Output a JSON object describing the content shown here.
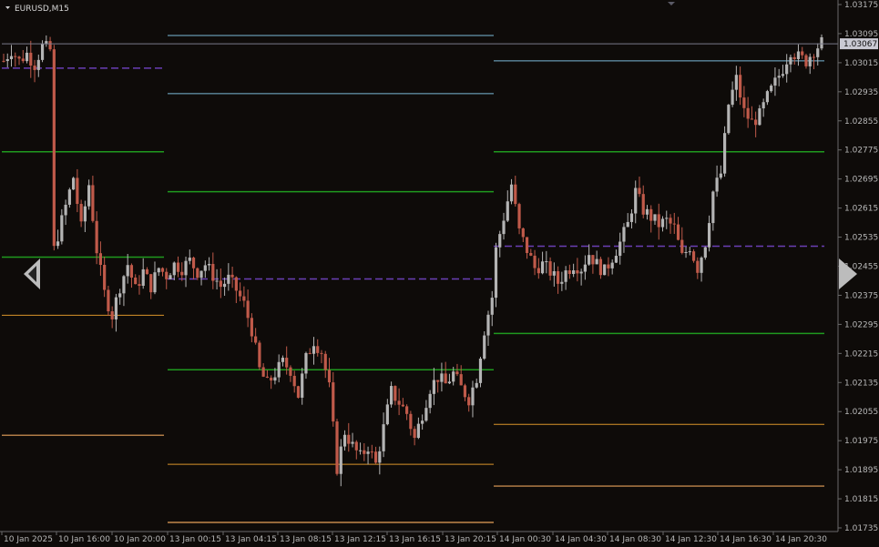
{
  "window": {
    "title": "EURUSD,M15"
  },
  "current_price_label": "1.03067",
  "colors": {
    "background": "#0e0b09",
    "axis": "#6a6a6a",
    "bull_candle": "#b4b4b4",
    "bear_candle": "#c05a4a",
    "pivot": "#6a3fb5",
    "resistance_far": "#7ab8d8",
    "resistance": "#1f9a1f",
    "support": "#d9932a",
    "support_far": "#e6a15a",
    "current_price_line": "#7a7a8a"
  },
  "chart_data": {
    "type": "candlestick",
    "symbol": "EURUSD",
    "timeframe": "M15",
    "y_ticks": [
      "1.03175",
      "1.03095",
      "1.03015",
      "1.02935",
      "1.02855",
      "1.02775",
      "1.02695",
      "1.02615",
      "1.02535",
      "1.02455",
      "1.02375",
      "1.02295",
      "1.02215",
      "1.02135",
      "1.02055",
      "1.01975",
      "1.01895",
      "1.01815",
      "1.01735"
    ],
    "x_ticks": [
      "10 Jan 2025",
      "10 Jan 16:00",
      "10 Jan 20:00",
      "13 Jan 00:15",
      "13 Jan 04:15",
      "13 Jan 08:15",
      "13 Jan 12:15",
      "13 Jan 16:15",
      "13 Jan 20:15",
      "14 Jan 00:30",
      "14 Jan 04:30",
      "14 Jan 08:30",
      "14 Jan 12:30",
      "14 Jan 16:30",
      "14 Jan 20:30"
    ],
    "ylim": [
      1.0171,
      1.0318
    ],
    "current_price": 1.03067,
    "pivot_levels": [
      {
        "segment": 1,
        "pivot": 1.03,
        "r1": 1.0277,
        "s1": 1.0248,
        "s2": 1.0232,
        "s3": 1.0199
      },
      {
        "segment": 2,
        "r3": 1.0309,
        "r2": 1.0293,
        "r1": 1.0266,
        "pivot": 1.0242,
        "s1": 1.0217,
        "s2": 1.0191,
        "s3": 1.0175
      },
      {
        "segment": 3,
        "r2": 1.0302,
        "r1": 1.0277,
        "pivot": 1.0251,
        "s1": 1.0227,
        "s2": 1.0202,
        "s3": 1.0185
      }
    ],
    "path": [
      [
        0,
        1.0302
      ],
      [
        2,
        1.0305
      ],
      [
        4,
        1.0302
      ],
      [
        6,
        1.0304
      ],
      [
        8,
        1.0301
      ],
      [
        10,
        1.0306
      ],
      [
        12,
        1.0305
      ],
      [
        13,
        1.025
      ],
      [
        16,
        1.0262
      ],
      [
        18,
        1.027
      ],
      [
        20,
        1.0256
      ],
      [
        22,
        1.0268
      ],
      [
        24,
        1.025
      ],
      [
        26,
        1.0238
      ],
      [
        28,
        1.0232
      ],
      [
        30,
        1.024
      ],
      [
        32,
        1.0246
      ],
      [
        34,
        1.0239
      ],
      [
        36,
        1.0244
      ],
      [
        38,
        1.024
      ],
      [
        40,
        1.0245
      ],
      [
        42,
        1.0243
      ],
      [
        44,
        1.0246
      ],
      [
        46,
        1.0245
      ],
      [
        48,
        1.0247
      ],
      [
        50,
        1.0244
      ],
      [
        52,
        1.0246
      ],
      [
        54,
        1.0243
      ],
      [
        56,
        1.024
      ],
      [
        58,
        1.0242
      ],
      [
        60,
        1.0239
      ],
      [
        62,
        1.0235
      ],
      [
        64,
        1.0228
      ],
      [
        66,
        1.0217
      ],
      [
        68,
        1.0213
      ],
      [
        70,
        1.0216
      ],
      [
        72,
        1.0219
      ],
      [
        74,
        1.0217
      ],
      [
        76,
        1.021
      ],
      [
        78,
        1.022
      ],
      [
        80,
        1.0225
      ],
      [
        82,
        1.0222
      ],
      [
        84,
        1.0212
      ],
      [
        86,
        1.019
      ],
      [
        88,
        1.02
      ],
      [
        90,
        1.0196
      ],
      [
        92,
        1.0193
      ],
      [
        94,
        1.0196
      ],
      [
        96,
        1.0191
      ],
      [
        98,
        1.0201
      ],
      [
        100,
        1.0211
      ],
      [
        102,
        1.0208
      ],
      [
        104,
        1.0205
      ],
      [
        106,
        1.0198
      ],
      [
        108,
        1.0205
      ],
      [
        110,
        1.0212
      ],
      [
        112,
        1.0215
      ],
      [
        114,
        1.0213
      ],
      [
        116,
        1.0216
      ],
      [
        118,
        1.0212
      ],
      [
        120,
        1.0209
      ],
      [
        122,
        1.0215
      ],
      [
        124,
        1.0228
      ],
      [
        126,
        1.0237
      ],
      [
        127,
        1.025
      ],
      [
        129,
        1.0259
      ],
      [
        131,
        1.0268
      ],
      [
        133,
        1.0255
      ],
      [
        135,
        1.025
      ],
      [
        137,
        1.0245
      ],
      [
        139,
        1.0246
      ],
      [
        141,
        1.0244
      ],
      [
        143,
        1.0241
      ],
      [
        145,
        1.0244
      ],
      [
        147,
        1.0246
      ],
      [
        149,
        1.0245
      ],
      [
        151,
        1.0249
      ],
      [
        153,
        1.0246
      ],
      [
        155,
        1.0244
      ],
      [
        157,
        1.0248
      ],
      [
        159,
        1.0252
      ],
      [
        161,
        1.0257
      ],
      [
        163,
        1.0266
      ],
      [
        165,
        1.0261
      ],
      [
        167,
        1.0259
      ],
      [
        169,
        1.0257
      ],
      [
        171,
        1.0258
      ],
      [
        173,
        1.0256
      ],
      [
        175,
        1.0248
      ],
      [
        177,
        1.0251
      ],
      [
        179,
        1.0245
      ],
      [
        181,
        1.0252
      ],
      [
        183,
        1.0266
      ],
      [
        185,
        1.0271
      ],
      [
        187,
        1.029
      ],
      [
        189,
        1.0297
      ],
      [
        191,
        1.0288
      ],
      [
        193,
        1.0285
      ],
      [
        195,
        1.0287
      ],
      [
        197,
        1.0292
      ],
      [
        199,
        1.0296
      ],
      [
        201,
        1.03
      ],
      [
        203,
        1.0305
      ],
      [
        205,
        1.0303
      ],
      [
        207,
        1.0302
      ],
      [
        209,
        1.0305
      ],
      [
        211,
        1.0307
      ]
    ]
  }
}
